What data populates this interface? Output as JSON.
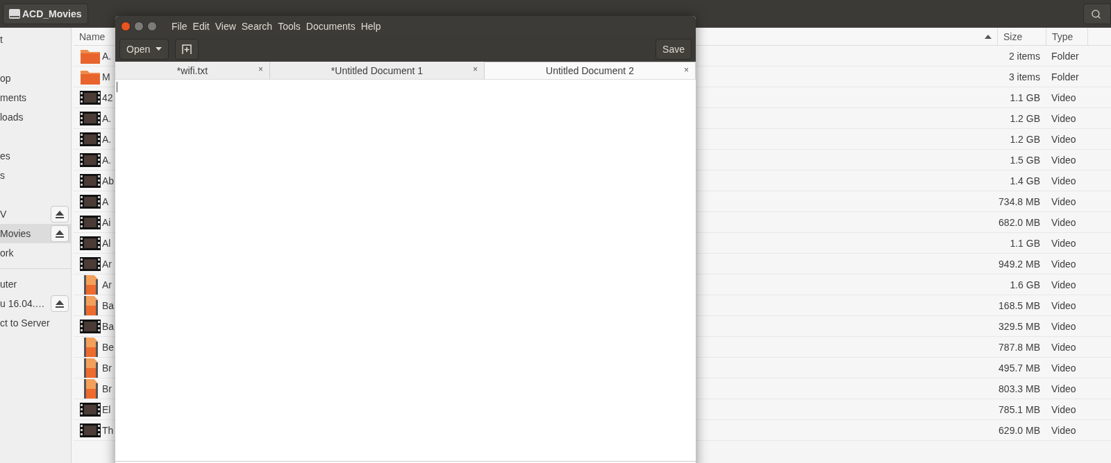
{
  "file_manager": {
    "location_button": "ACD_Movies",
    "sidebar": {
      "sections": [
        [
          {
            "label": "t",
            "selected": false,
            "eject": false
          }
        ],
        [
          {
            "label": "op",
            "selected": false,
            "eject": false
          },
          {
            "label": "ments",
            "selected": false,
            "eject": false
          },
          {
            "label": "loads",
            "selected": false,
            "eject": false
          }
        ],
        [
          {
            "label": "es",
            "selected": false,
            "eject": false
          },
          {
            "label": "s",
            "selected": false,
            "eject": false
          }
        ],
        [
          {
            "label": "V",
            "selected": false,
            "eject": true
          },
          {
            "label": "Movies",
            "selected": true,
            "eject": true
          },
          {
            "label": "ork",
            "selected": false,
            "eject": false
          }
        ],
        [
          {
            "label": "uter",
            "selected": false,
            "eject": false
          },
          {
            "label": "u 16.04.…",
            "selected": false,
            "eject": true
          },
          {
            "label": "ct to Server",
            "selected": false,
            "eject": false
          }
        ]
      ]
    },
    "columns": [
      "Name",
      "Size",
      "Type"
    ],
    "rows": [
      {
        "kind": "folder",
        "name": "A.",
        "size": "2 items",
        "type": "Folder"
      },
      {
        "kind": "folder",
        "name": "M",
        "size": "3 items",
        "type": "Folder"
      },
      {
        "kind": "thumbnail",
        "name": "42",
        "size": "1.1 GB",
        "type": "Video"
      },
      {
        "kind": "thumbnail",
        "name": "A.",
        "size": "1.2 GB",
        "type": "Video"
      },
      {
        "kind": "thumbnail",
        "name": "A.",
        "size": "1.2 GB",
        "type": "Video"
      },
      {
        "kind": "thumbnail",
        "name": "A.",
        "size": "1.5 GB",
        "type": "Video"
      },
      {
        "kind": "thumbnail",
        "name": "Ab",
        "size": "1.4 GB",
        "type": "Video"
      },
      {
        "kind": "thumbnail",
        "name": "A",
        "size": "734.8 MB",
        "type": "Video"
      },
      {
        "kind": "thumbnail",
        "name": "Ai",
        "size": "682.0 MB",
        "type": "Video"
      },
      {
        "kind": "thumbnail",
        "name": "Al",
        "size": "1.1 GB",
        "type": "Video"
      },
      {
        "kind": "thumbnail",
        "name": "Ar",
        "size": "949.2 MB",
        "type": "Video"
      },
      {
        "kind": "video",
        "name": "Ar",
        "size": "1.6 GB",
        "type": "Video"
      },
      {
        "kind": "video",
        "name": "Ba",
        "size": "168.5 MB",
        "type": "Video"
      },
      {
        "kind": "thumbnail",
        "name": "Ba",
        "size": "329.5 MB",
        "type": "Video"
      },
      {
        "kind": "video",
        "name": "Be",
        "size": "787.8 MB",
        "type": "Video"
      },
      {
        "kind": "video",
        "name": "Br",
        "size": "495.7 MB",
        "type": "Video"
      },
      {
        "kind": "video",
        "name": "Br",
        "size": "803.3 MB",
        "type": "Video"
      },
      {
        "kind": "thumbnail",
        "name": "El",
        "size": "785.1 MB",
        "type": "Video"
      },
      {
        "kind": "thumbnail",
        "name": "Th",
        "size": "629.0 MB",
        "type": "Video"
      }
    ]
  },
  "editor": {
    "menu": [
      "File",
      "Edit",
      "View",
      "Search",
      "Tools",
      "Documents",
      "Help"
    ],
    "toolbar": {
      "open": "Open",
      "save": "Save"
    },
    "tabs": [
      {
        "label": "*wifi.txt",
        "selected": false,
        "close": "×"
      },
      {
        "label": "*Untitled Document 1",
        "selected": false,
        "close": "×"
      },
      {
        "label": "Untitled Document 2",
        "selected": true,
        "close": "×"
      }
    ]
  }
}
